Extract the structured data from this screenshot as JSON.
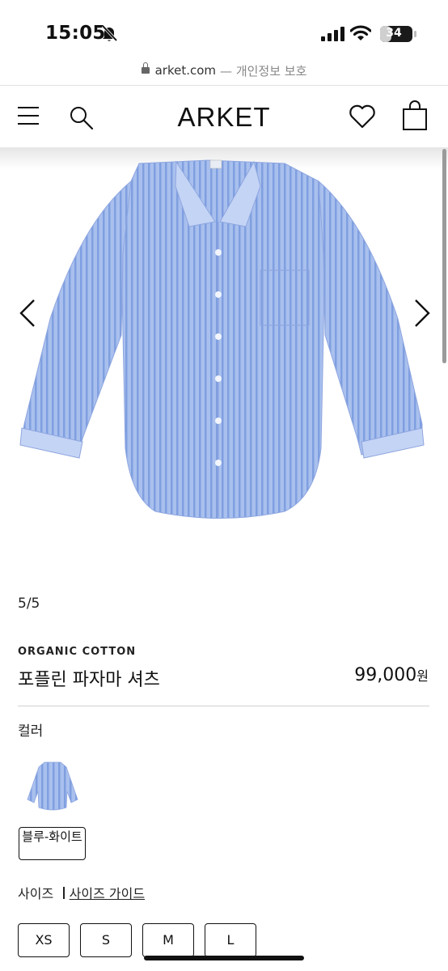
{
  "status": {
    "time": "15:05",
    "battery": "34",
    "battery_level": 0.34
  },
  "browser": {
    "url": "arket.com",
    "url_suffix": "— 개인정보 보호"
  },
  "header": {
    "logo": "ARKET"
  },
  "gallery": {
    "counter": "5/5",
    "product_colors": {
      "shirt": "#a9c0ee",
      "stripe": "#7f9fe0"
    }
  },
  "product": {
    "collection": "ORGANIC COTTON",
    "name": "포플린 파자마 셔츠",
    "price": "99,000",
    "currency": "원"
  },
  "color": {
    "label": "컬러",
    "selected": "블루-화이트"
  },
  "size": {
    "label": "사이즈",
    "separator": "I",
    "guide_link": "사이즈 가이드",
    "options": [
      "XS",
      "S",
      "M",
      "L"
    ]
  }
}
